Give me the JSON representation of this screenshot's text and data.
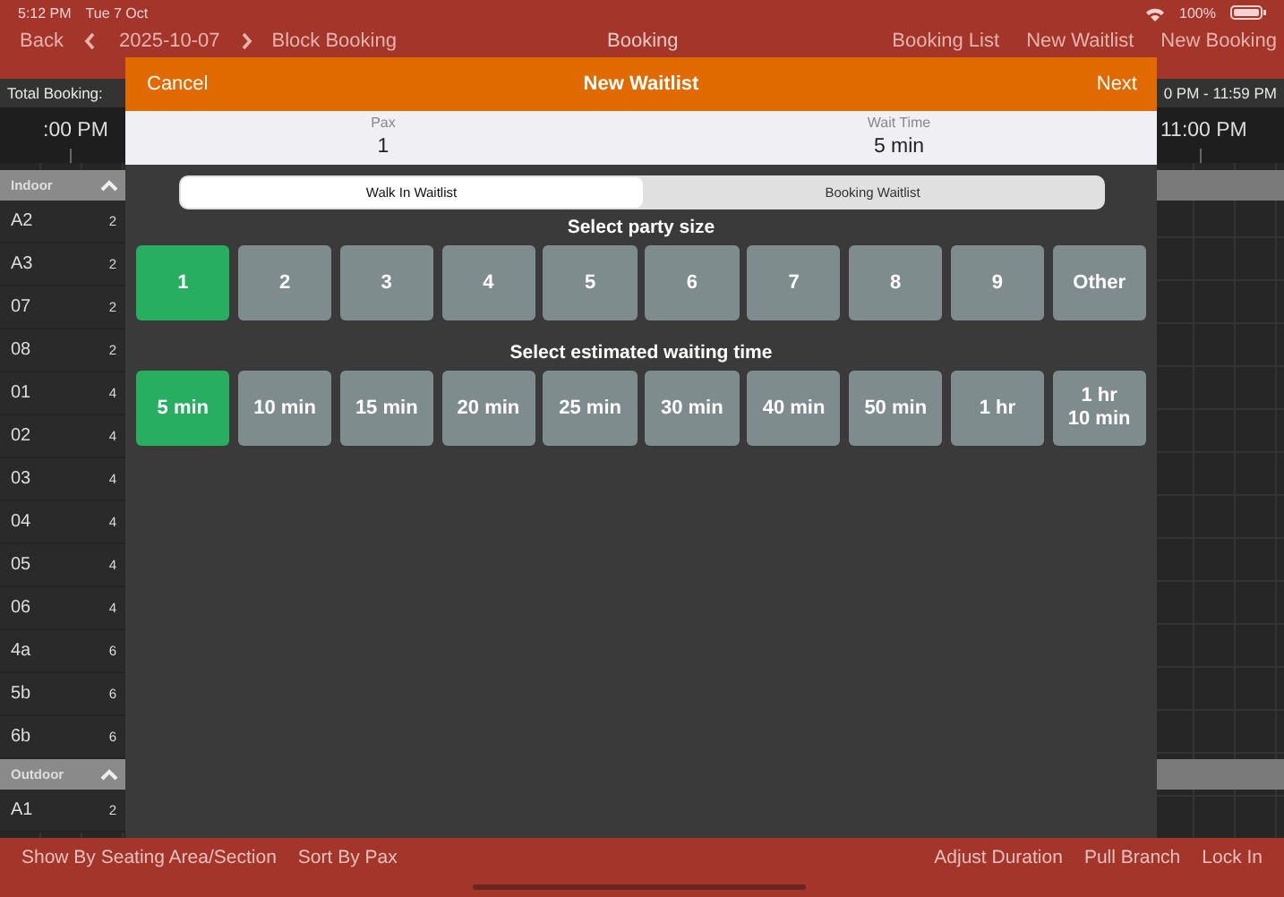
{
  "status_bar": {
    "time": "5:12 PM",
    "date": "Tue 7 Oct",
    "battery": "100%"
  },
  "nav": {
    "back": "Back",
    "date": "2025-10-07",
    "block": "Block Booking",
    "title": "Booking",
    "actions": [
      "Booking List",
      "New Waitlist",
      "New Booking"
    ]
  },
  "summary": {
    "total": "Total Booking:",
    "range": "0 PM - 11:59 PM"
  },
  "timeline": {
    "left": ":00 PM",
    "right": "11:00 PM"
  },
  "sections": [
    {
      "name": "Indoor",
      "expanded": true,
      "tables": [
        {
          "name": "A2",
          "pax": "2"
        },
        {
          "name": "A3",
          "pax": "2"
        },
        {
          "name": "07",
          "pax": "2"
        },
        {
          "name": "08",
          "pax": "2"
        },
        {
          "name": "01",
          "pax": "4"
        },
        {
          "name": "02",
          "pax": "4"
        },
        {
          "name": "03",
          "pax": "4"
        },
        {
          "name": "04",
          "pax": "4"
        },
        {
          "name": "05",
          "pax": "4"
        },
        {
          "name": "06",
          "pax": "4"
        },
        {
          "name": "4a",
          "pax": "6"
        },
        {
          "name": "5b",
          "pax": "6"
        },
        {
          "name": "6b",
          "pax": "6"
        }
      ]
    },
    {
      "name": "Outdoor",
      "expanded": true,
      "tables": [
        {
          "name": "A1",
          "pax": "2"
        }
      ]
    }
  ],
  "modal": {
    "cancel": "Cancel",
    "title": "New Waitlist",
    "next": "Next",
    "fields": [
      {
        "label": "Pax",
        "value": "1"
      },
      {
        "label": "Wait Time",
        "value": "5 min"
      }
    ],
    "tabs": [
      {
        "label": "Walk In Waitlist",
        "selected": true
      },
      {
        "label": "Booking Waitlist",
        "selected": false
      }
    ],
    "party_size": {
      "title": "Select party size",
      "options": [
        {
          "label": "1",
          "selected": true
        },
        {
          "label": "2",
          "selected": false
        },
        {
          "label": "3",
          "selected": false
        },
        {
          "label": "4",
          "selected": false
        },
        {
          "label": "5",
          "selected": false
        },
        {
          "label": "6",
          "selected": false
        },
        {
          "label": "7",
          "selected": false
        },
        {
          "label": "8",
          "selected": false
        },
        {
          "label": "9",
          "selected": false
        },
        {
          "label": "Other",
          "selected": false
        }
      ]
    },
    "wait_time": {
      "title": "Select estimated waiting time",
      "options": [
        {
          "label": "5 min",
          "selected": true
        },
        {
          "label": "10 min",
          "selected": false
        },
        {
          "label": "15 min",
          "selected": false
        },
        {
          "label": "20 min",
          "selected": false
        },
        {
          "label": "25 min",
          "selected": false
        },
        {
          "label": "30 min",
          "selected": false
        },
        {
          "label": "40 min",
          "selected": false
        },
        {
          "label": "50 min",
          "selected": false
        },
        {
          "label": "1 hr",
          "selected": false
        },
        {
          "label": "1 hr\n10 min",
          "selected": false
        }
      ]
    }
  },
  "bottom_bar": {
    "left": [
      "Show By Seating Area/Section",
      "Sort By Pax"
    ],
    "right": [
      "Adjust Duration",
      "Pull Branch",
      "Lock In"
    ]
  }
}
